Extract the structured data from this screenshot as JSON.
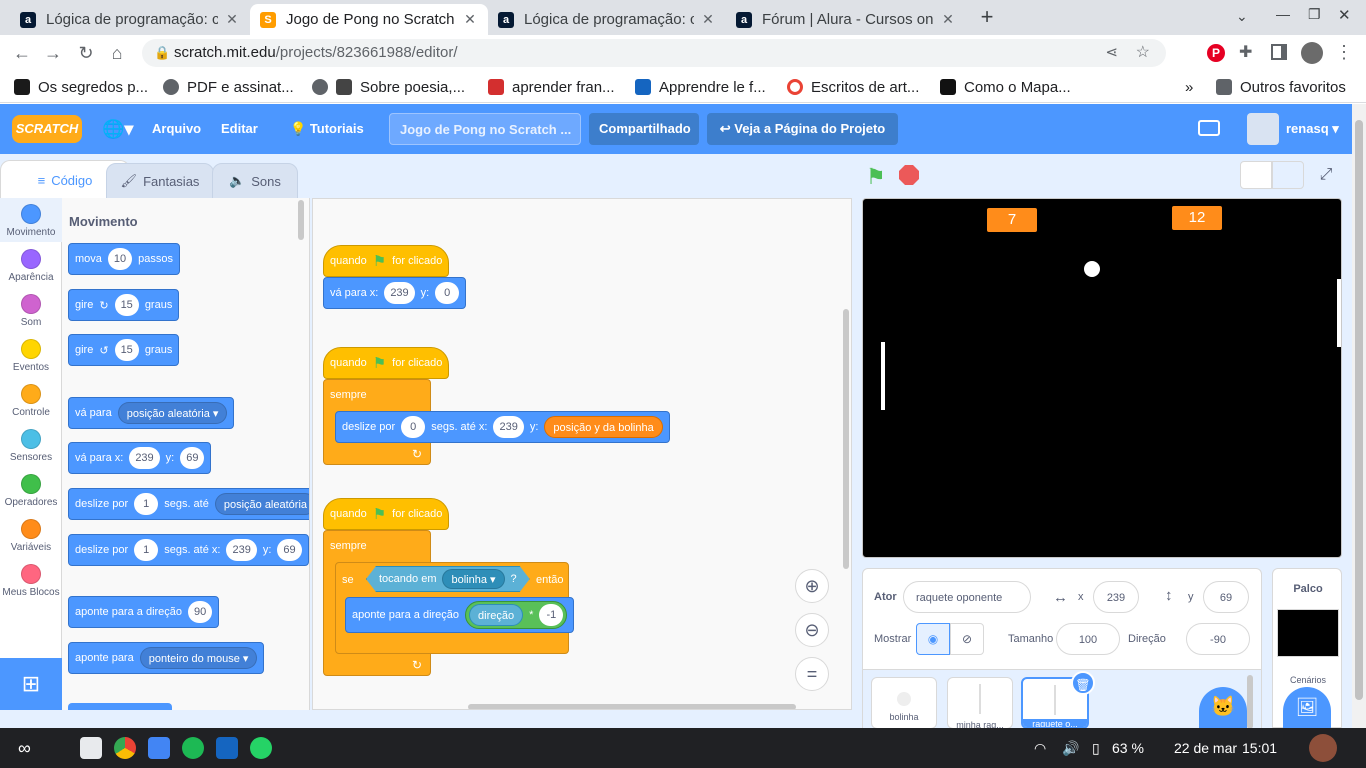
{
  "browser": {
    "tabs": [
      {
        "title": "Lógica de programação: c",
        "favicon": "a",
        "color": "#051933"
      },
      {
        "title": "Jogo de Pong no Scratch",
        "favicon": "S",
        "color": "#ff9d00",
        "active": true
      },
      {
        "title": "Lógica de programação: c",
        "favicon": "a",
        "color": "#051933"
      },
      {
        "title": "Fórum | Alura - Cursos on",
        "favicon": "a",
        "color": "#051933"
      }
    ],
    "new_tab": "+",
    "url_domain": "scratch.mit.edu",
    "url_path": "/projects/823661988/editor/",
    "bookmarks": [
      "Os segredos p...",
      "PDF e assinat...",
      "Sobre poesia,...",
      "aprender fran...",
      "Apprendre le f...",
      "Escritos de art...",
      "Como o Mapa..."
    ],
    "bookmarks_more": "»",
    "other_bookmarks": "Outros favoritos"
  },
  "menu": {
    "logo": "SCRATCH",
    "arquivo": "Arquivo",
    "editar": "Editar",
    "tutoriais": "Tutoriais",
    "project_title": "Jogo de Pong no Scratch ...",
    "shared": "Compartilhado",
    "project_page": "Veja a Página do Projeto",
    "user": "renasq"
  },
  "editor_tabs": {
    "code": "Código",
    "costumes": "Fantasias",
    "sounds": "Sons"
  },
  "categories": [
    {
      "label": "Movimento",
      "color": "#4c97ff"
    },
    {
      "label": "Aparência",
      "color": "#9966ff"
    },
    {
      "label": "Som",
      "color": "#cf63cf"
    },
    {
      "label": "Eventos",
      "color": "#ffd500"
    },
    {
      "label": "Controle",
      "color": "#ffab19"
    },
    {
      "label": "Sensores",
      "color": "#4cbfe6"
    },
    {
      "label": "Operadores",
      "color": "#40bf4a"
    },
    {
      "label": "Variáveis",
      "color": "#ff8c1a"
    },
    {
      "label": "Meus Blocos",
      "color": "#ff6680"
    }
  ],
  "palette": {
    "heading": "Movimento",
    "move": {
      "a": "mova",
      "n": "10",
      "b": "passos"
    },
    "turn_right": {
      "a": "gire",
      "n": "15",
      "b": "graus"
    },
    "turn_left": {
      "a": "gire",
      "n": "15",
      "b": "graus"
    },
    "goto": {
      "a": "vá para",
      "dd": "posição aleatória"
    },
    "gotoxy": {
      "a": "vá para x:",
      "x": "239",
      "b": "y:",
      "y": "69"
    },
    "glide": {
      "a": "deslize por",
      "n": "1",
      "b": "segs. até",
      "dd": "posição aleatória"
    },
    "glidexy": {
      "a": "deslize por",
      "n": "1",
      "b": "segs. até x:",
      "x": "239",
      "c": "y:",
      "y": "69"
    },
    "point": {
      "a": "aponte para a direção",
      "n": "90"
    },
    "pointto": {
      "a": "aponte para",
      "dd": "ponteiro do mouse"
    }
  },
  "scripts": {
    "s1_hat": {
      "a": "quando",
      "b": "for clicado"
    },
    "s1_goto": {
      "a": "vá para x:",
      "x": "239",
      "b": "y:",
      "y": "0"
    },
    "s2_hat": {
      "a": "quando",
      "b": "for clicado"
    },
    "s2_forever": "sempre",
    "s2_glide": {
      "a": "deslize por",
      "n": "0",
      "b": "segs. até x:",
      "x": "239",
      "c": "y:",
      "var": "posição y da bolinha"
    },
    "s3_hat": {
      "a": "quando",
      "b": "for clicado"
    },
    "s3_forever": "sempre",
    "s3_if": {
      "a": "se",
      "touch": "tocando em",
      "obj": "bolinha",
      "q": "?",
      "b": "então"
    },
    "s3_point": {
      "a": "aponte para a direção",
      "var": "direção",
      "op": "*",
      "n": "-1"
    }
  },
  "stage": {
    "score_left": "7",
    "score_right": "12"
  },
  "sprite_info": {
    "ator_label": "Ator",
    "ator": "raquete oponente",
    "x_label": "x",
    "x": "239",
    "y_label": "y",
    "y": "69",
    "mostrar": "Mostrar",
    "tamanho_label": "Tamanho",
    "tamanho": "100",
    "direcao_label": "Direção",
    "direcao": "-90",
    "sprites": [
      "bolinha",
      "minha rag...",
      "raquete o..."
    ]
  },
  "stage_panel": {
    "title": "Palco",
    "backdrops": "Cenários"
  },
  "taskbar": {
    "battery": "63 %",
    "date": "22 de mar",
    "time": "15:01"
  }
}
